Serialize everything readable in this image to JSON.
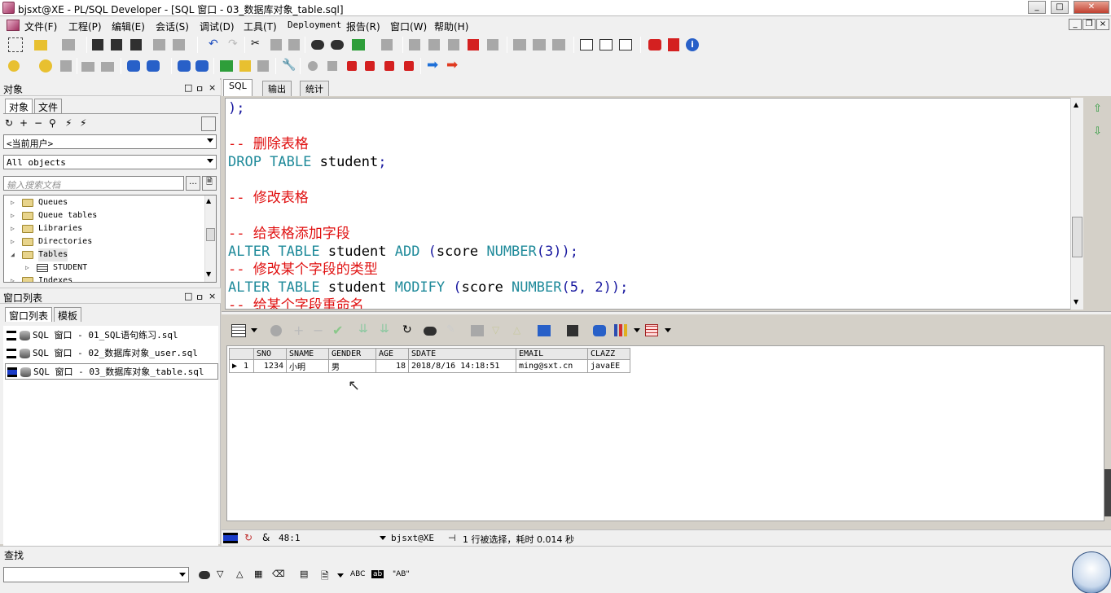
{
  "window": {
    "title": "bjsxt@XE - PL/SQL Developer - [SQL 窗口 - 03_数据库对象_table.sql]",
    "min": "0",
    "max": "1",
    "close": "r"
  },
  "menu": {
    "items": [
      "文件(F)",
      "工程(P)",
      "编辑(E)",
      "会话(S)",
      "调试(D)",
      "工具(T)",
      "Deployment",
      "报告(R)",
      "窗口(W)",
      "帮助(H)"
    ]
  },
  "objects_pane": {
    "header": "对象",
    "tabs": [
      "对象",
      "文件"
    ],
    "user_combo": "<当前用户>",
    "filter_combo": "All objects",
    "search_placeholder": "输入搜索文档",
    "tree": [
      {
        "label": "Queues",
        "expanded": false
      },
      {
        "label": "Queue tables",
        "expanded": false
      },
      {
        "label": "Libraries",
        "expanded": false
      },
      {
        "label": "Directories",
        "expanded": false
      },
      {
        "label": "Tables",
        "expanded": true
      },
      {
        "label": "STUDENT",
        "child": true
      },
      {
        "label": "Indexes",
        "expanded": false
      }
    ]
  },
  "window_list": {
    "header": "窗口列表",
    "tabs": [
      "窗口列表",
      "模板"
    ],
    "items": [
      "SQL 窗口 - 01_SQL语句练习.sql",
      "SQL 窗口 - 02_数据库对象_user.sql",
      "SQL 窗口 - 03_数据库对象_table.sql"
    ]
  },
  "editor": {
    "tabs": [
      "SQL",
      "输出",
      "统计"
    ],
    "lines": [
      {
        "parts": [
          {
            "t": ");",
            "c": "pu"
          }
        ]
      },
      {
        "parts": []
      },
      {
        "parts": [
          {
            "t": "-- 删除表格",
            "c": "cm"
          }
        ]
      },
      {
        "parts": [
          {
            "t": "DROP TABLE ",
            "c": "kw"
          },
          {
            "t": "student",
            "c": "id"
          },
          {
            "t": ";",
            "c": "pu"
          }
        ]
      },
      {
        "parts": []
      },
      {
        "parts": [
          {
            "t": "-- 修改表格",
            "c": "cm"
          }
        ]
      },
      {
        "parts": []
      },
      {
        "parts": [
          {
            "t": "-- 给表格添加字段",
            "c": "cm"
          }
        ]
      },
      {
        "parts": [
          {
            "t": "ALTER TABLE ",
            "c": "kw"
          },
          {
            "t": "student ",
            "c": "id"
          },
          {
            "t": "ADD ",
            "c": "kw"
          },
          {
            "t": "(",
            "c": "pu"
          },
          {
            "t": "score ",
            "c": "id"
          },
          {
            "t": "NUMBER",
            "c": "kw"
          },
          {
            "t": "(3));",
            "c": "pu"
          }
        ]
      },
      {
        "parts": [
          {
            "t": "-- 修改某个字段的类型",
            "c": "cm"
          }
        ]
      },
      {
        "parts": [
          {
            "t": "ALTER TABLE ",
            "c": "kw"
          },
          {
            "t": "student ",
            "c": "id"
          },
          {
            "t": "MODIFY ",
            "c": "kw"
          },
          {
            "t": "(",
            "c": "pu"
          },
          {
            "t": "score ",
            "c": "id"
          },
          {
            "t": "NUMBER",
            "c": "kw"
          },
          {
            "t": "(5, 2));",
            "c": "pu"
          }
        ]
      },
      {
        "parts": [
          {
            "t": "-- 给某个字段重命名",
            "c": "cm"
          }
        ]
      }
    ]
  },
  "grid": {
    "columns": [
      "",
      "SNO",
      "SNAME",
      "GENDER",
      "AGE",
      "SDATE",
      "EMAIL",
      "CLAZZ"
    ],
    "rows": [
      {
        "marker": "▶",
        "num": "1",
        "cells": [
          "1234",
          "小明",
          "男",
          "18",
          "2018/8/16 14:18:51",
          "ming@sxt.cn",
          "javaEE"
        ]
      }
    ]
  },
  "status": {
    "position": "48:1",
    "connection": "bjsxt@XE",
    "message": "1 行被选择，耗时 0.014 秒"
  },
  "find": {
    "label": "查找",
    "abc": "ABC",
    "ab_quoted": "\"AB\""
  }
}
